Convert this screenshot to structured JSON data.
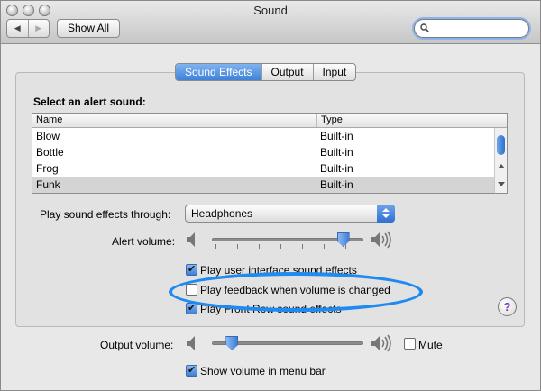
{
  "window": {
    "title": "Sound"
  },
  "toolbar": {
    "back_label": "◀",
    "forward_label": "▶",
    "show_all_label": "Show All",
    "search_value": ""
  },
  "tabs": [
    {
      "label": "Sound Effects",
      "active": true
    },
    {
      "label": "Output",
      "active": false
    },
    {
      "label": "Input",
      "active": false
    }
  ],
  "alert_list": {
    "heading": "Select an alert sound:",
    "columns": [
      "Name",
      "Type"
    ],
    "rows": [
      {
        "name": "Blow",
        "type": "Built-in"
      },
      {
        "name": "Bottle",
        "type": "Built-in"
      },
      {
        "name": "Frog",
        "type": "Built-in"
      },
      {
        "name": "Funk",
        "type": "Built-in",
        "selected": true
      }
    ]
  },
  "play_through": {
    "label": "Play sound effects through:",
    "value": "Headphones"
  },
  "alert_volume": {
    "label": "Alert volume:",
    "level": 0.9
  },
  "options": {
    "ui_effects": {
      "label": "Play user interface sound effects",
      "checked": true
    },
    "feedback": {
      "label": "Play feedback when volume is changed",
      "checked": false
    },
    "front_row": {
      "label": "Play Front Row sound effects",
      "checked": true
    }
  },
  "output_volume": {
    "label": "Output volume:",
    "level": 0.1,
    "mute_label": "Mute",
    "mute_checked": false
  },
  "menu_bar": {
    "label": "Show volume in menu bar",
    "checked": true
  },
  "help": {
    "label": "?"
  },
  "colors": {
    "accent": "#3f82da",
    "highlight_oval": "#1f8af0"
  }
}
